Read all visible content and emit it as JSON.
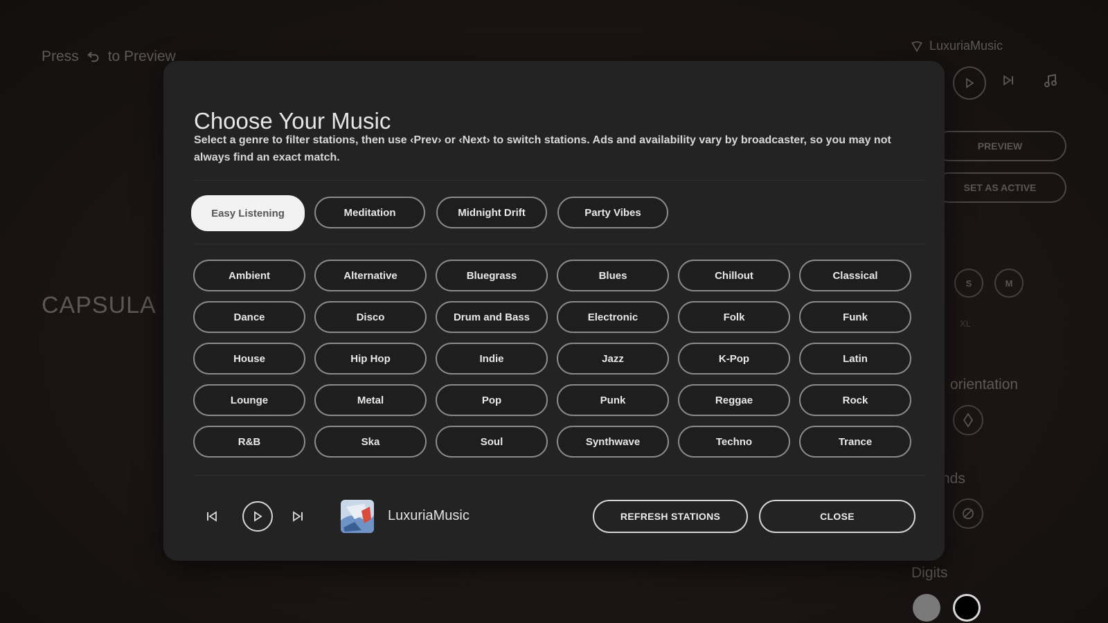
{
  "background": {
    "hint_prefix": "Press",
    "hint_suffix": "to Preview",
    "title": "CAPSULA S",
    "brand": "LuxuriaMusic",
    "preview_label": "PREVIEW",
    "set_active_label": "SET AS ACTIVE",
    "size_options": [
      "S",
      "M"
    ],
    "xl_label": "XL",
    "orientation_label": "orientation",
    "sounds_label": "nds",
    "digits_label": "Digits",
    "colors": {
      "digit_gray": "#7a7a7a",
      "digit_black": "#000000"
    }
  },
  "modal": {
    "title": "Choose Your Music",
    "description": "Select a genre to filter stations, then use ‹Prev› or ‹Next› to switch stations. Ads and availability vary by broadcaster, so you may not always find an exact match.",
    "moods": [
      {
        "label": "Easy Listening",
        "active": true
      },
      {
        "label": "Meditation",
        "active": false
      },
      {
        "label": "Midnight Drift",
        "active": false
      },
      {
        "label": "Party Vibes",
        "active": false
      }
    ],
    "genres": [
      "Ambient",
      "Alternative",
      "Bluegrass",
      "Blues",
      "Chillout",
      "Classical",
      "Dance",
      "Disco",
      "Drum and Bass",
      "Electronic",
      "Folk",
      "Funk",
      "House",
      "Hip Hop",
      "Indie",
      "Jazz",
      "K-Pop",
      "Latin",
      "Lounge",
      "Metal",
      "Pop",
      "Punk",
      "Reggae",
      "Rock",
      "R&B",
      "Ska",
      "Soul",
      "Synthwave",
      "Techno",
      "Trance"
    ],
    "player": {
      "station_name": "LuxuriaMusic",
      "prev_icon": "skip-previous-icon",
      "play_icon": "play-icon",
      "next_icon": "skip-next-icon"
    },
    "buttons": {
      "refresh": "REFRESH STATIONS",
      "close": "CLOSE"
    }
  }
}
